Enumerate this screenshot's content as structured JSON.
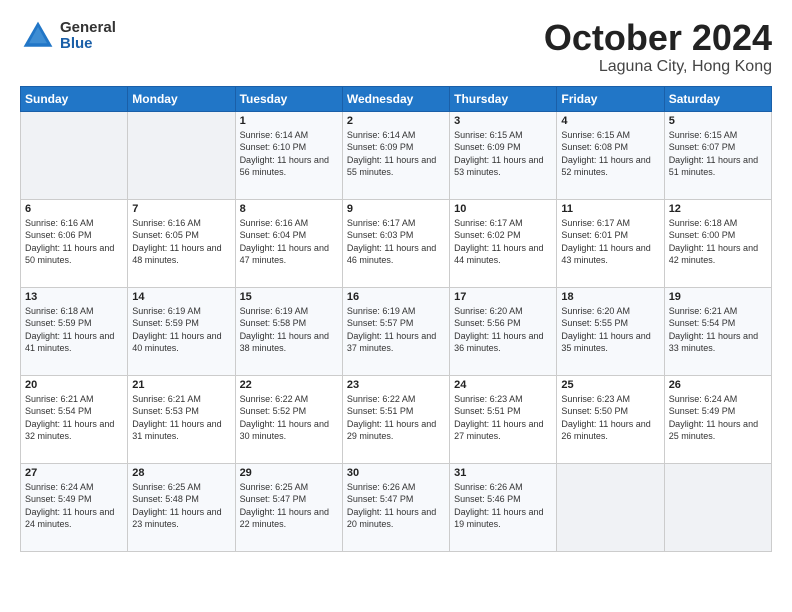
{
  "logo": {
    "general": "General",
    "blue": "Blue"
  },
  "title": "October 2024",
  "subtitle": "Laguna City, Hong Kong",
  "days_header": [
    "Sunday",
    "Monday",
    "Tuesday",
    "Wednesday",
    "Thursday",
    "Friday",
    "Saturday"
  ],
  "weeks": [
    [
      {
        "day": "",
        "info": ""
      },
      {
        "day": "",
        "info": ""
      },
      {
        "day": "1",
        "info": "Sunrise: 6:14 AM\nSunset: 6:10 PM\nDaylight: 11 hours and 56 minutes."
      },
      {
        "day": "2",
        "info": "Sunrise: 6:14 AM\nSunset: 6:09 PM\nDaylight: 11 hours and 55 minutes."
      },
      {
        "day": "3",
        "info": "Sunrise: 6:15 AM\nSunset: 6:09 PM\nDaylight: 11 hours and 53 minutes."
      },
      {
        "day": "4",
        "info": "Sunrise: 6:15 AM\nSunset: 6:08 PM\nDaylight: 11 hours and 52 minutes."
      },
      {
        "day": "5",
        "info": "Sunrise: 6:15 AM\nSunset: 6:07 PM\nDaylight: 11 hours and 51 minutes."
      }
    ],
    [
      {
        "day": "6",
        "info": "Sunrise: 6:16 AM\nSunset: 6:06 PM\nDaylight: 11 hours and 50 minutes."
      },
      {
        "day": "7",
        "info": "Sunrise: 6:16 AM\nSunset: 6:05 PM\nDaylight: 11 hours and 48 minutes."
      },
      {
        "day": "8",
        "info": "Sunrise: 6:16 AM\nSunset: 6:04 PM\nDaylight: 11 hours and 47 minutes."
      },
      {
        "day": "9",
        "info": "Sunrise: 6:17 AM\nSunset: 6:03 PM\nDaylight: 11 hours and 46 minutes."
      },
      {
        "day": "10",
        "info": "Sunrise: 6:17 AM\nSunset: 6:02 PM\nDaylight: 11 hours and 44 minutes."
      },
      {
        "day": "11",
        "info": "Sunrise: 6:17 AM\nSunset: 6:01 PM\nDaylight: 11 hours and 43 minutes."
      },
      {
        "day": "12",
        "info": "Sunrise: 6:18 AM\nSunset: 6:00 PM\nDaylight: 11 hours and 42 minutes."
      }
    ],
    [
      {
        "day": "13",
        "info": "Sunrise: 6:18 AM\nSunset: 5:59 PM\nDaylight: 11 hours and 41 minutes."
      },
      {
        "day": "14",
        "info": "Sunrise: 6:19 AM\nSunset: 5:59 PM\nDaylight: 11 hours and 40 minutes."
      },
      {
        "day": "15",
        "info": "Sunrise: 6:19 AM\nSunset: 5:58 PM\nDaylight: 11 hours and 38 minutes."
      },
      {
        "day": "16",
        "info": "Sunrise: 6:19 AM\nSunset: 5:57 PM\nDaylight: 11 hours and 37 minutes."
      },
      {
        "day": "17",
        "info": "Sunrise: 6:20 AM\nSunset: 5:56 PM\nDaylight: 11 hours and 36 minutes."
      },
      {
        "day": "18",
        "info": "Sunrise: 6:20 AM\nSunset: 5:55 PM\nDaylight: 11 hours and 35 minutes."
      },
      {
        "day": "19",
        "info": "Sunrise: 6:21 AM\nSunset: 5:54 PM\nDaylight: 11 hours and 33 minutes."
      }
    ],
    [
      {
        "day": "20",
        "info": "Sunrise: 6:21 AM\nSunset: 5:54 PM\nDaylight: 11 hours and 32 minutes."
      },
      {
        "day": "21",
        "info": "Sunrise: 6:21 AM\nSunset: 5:53 PM\nDaylight: 11 hours and 31 minutes."
      },
      {
        "day": "22",
        "info": "Sunrise: 6:22 AM\nSunset: 5:52 PM\nDaylight: 11 hours and 30 minutes."
      },
      {
        "day": "23",
        "info": "Sunrise: 6:22 AM\nSunset: 5:51 PM\nDaylight: 11 hours and 29 minutes."
      },
      {
        "day": "24",
        "info": "Sunrise: 6:23 AM\nSunset: 5:51 PM\nDaylight: 11 hours and 27 minutes."
      },
      {
        "day": "25",
        "info": "Sunrise: 6:23 AM\nSunset: 5:50 PM\nDaylight: 11 hours and 26 minutes."
      },
      {
        "day": "26",
        "info": "Sunrise: 6:24 AM\nSunset: 5:49 PM\nDaylight: 11 hours and 25 minutes."
      }
    ],
    [
      {
        "day": "27",
        "info": "Sunrise: 6:24 AM\nSunset: 5:49 PM\nDaylight: 11 hours and 24 minutes."
      },
      {
        "day": "28",
        "info": "Sunrise: 6:25 AM\nSunset: 5:48 PM\nDaylight: 11 hours and 23 minutes."
      },
      {
        "day": "29",
        "info": "Sunrise: 6:25 AM\nSunset: 5:47 PM\nDaylight: 11 hours and 22 minutes."
      },
      {
        "day": "30",
        "info": "Sunrise: 6:26 AM\nSunset: 5:47 PM\nDaylight: 11 hours and 20 minutes."
      },
      {
        "day": "31",
        "info": "Sunrise: 6:26 AM\nSunset: 5:46 PM\nDaylight: 11 hours and 19 minutes."
      },
      {
        "day": "",
        "info": ""
      },
      {
        "day": "",
        "info": ""
      }
    ]
  ]
}
